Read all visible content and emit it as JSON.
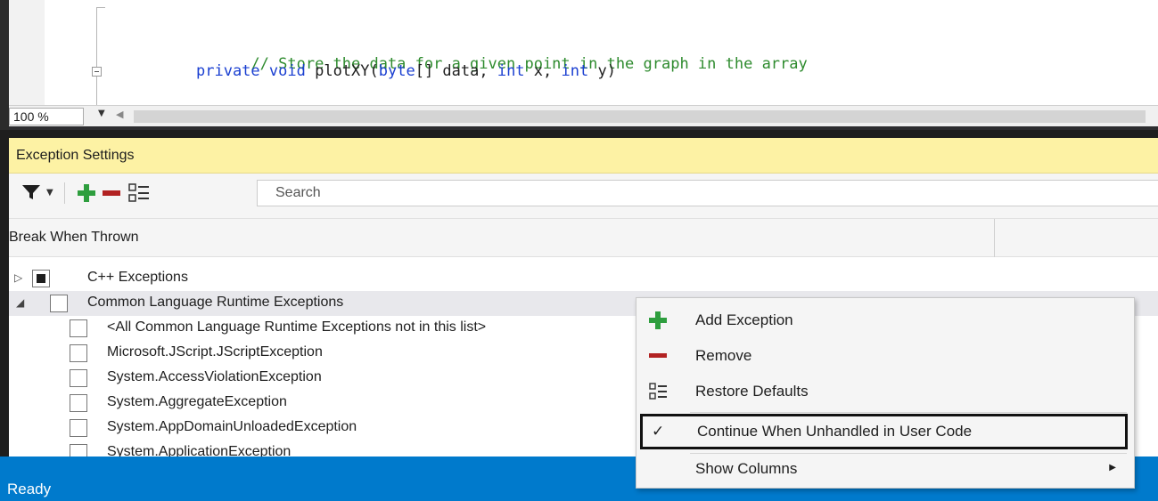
{
  "editor": {
    "code": {
      "line1": {
        "comment": "// Store the data for a given point in the graph in the array"
      },
      "line2": {
        "kw1": "private",
        "sp1": " ",
        "kw2": "void",
        "name": " plotXY(",
        "kw3": "byte",
        "mid1": "[] data, ",
        "kw4": "int",
        "mid2": " x, ",
        "kw5": "int",
        "end": " y)"
      },
      "line3": {
        "text": "{"
      }
    },
    "zoom": {
      "value": "100 %"
    }
  },
  "panel": {
    "title": "Exception Settings",
    "search_placeholder": "Search",
    "column_header": "Break When Thrown",
    "rows": [
      {
        "label": "C++ Exceptions",
        "expander": "▷",
        "checked": true
      },
      {
        "label": "Common Language Runtime Exceptions",
        "expander": "◢",
        "checked": false
      },
      {
        "label": "<All Common Language Runtime Exceptions not in this list>"
      },
      {
        "label": "Microsoft.JScript.JScriptException"
      },
      {
        "label": "System.AccessViolationException"
      },
      {
        "label": "System.AggregateException"
      },
      {
        "label": "System.AppDomainUnloadedException"
      },
      {
        "label": "System.ApplicationException"
      }
    ]
  },
  "context_menu": {
    "items": [
      {
        "label": "Add Exception",
        "icon": "add-icon"
      },
      {
        "label": "Remove",
        "icon": "remove-icon"
      },
      {
        "label": "Restore Defaults",
        "icon": "restore-defaults-icon"
      },
      {
        "label": "Continue When Unhandled in User Code",
        "icon": "checkmark-icon",
        "check": "✓"
      },
      {
        "label": "Show Columns",
        "icon": "submenu-arrow-icon"
      }
    ]
  },
  "status": {
    "text": "Ready"
  },
  "colors": {
    "accent": "#007acc",
    "panel_title_bg": "#fdf2a4",
    "add_green": "#2e9e3e",
    "remove_red": "#b22222"
  }
}
